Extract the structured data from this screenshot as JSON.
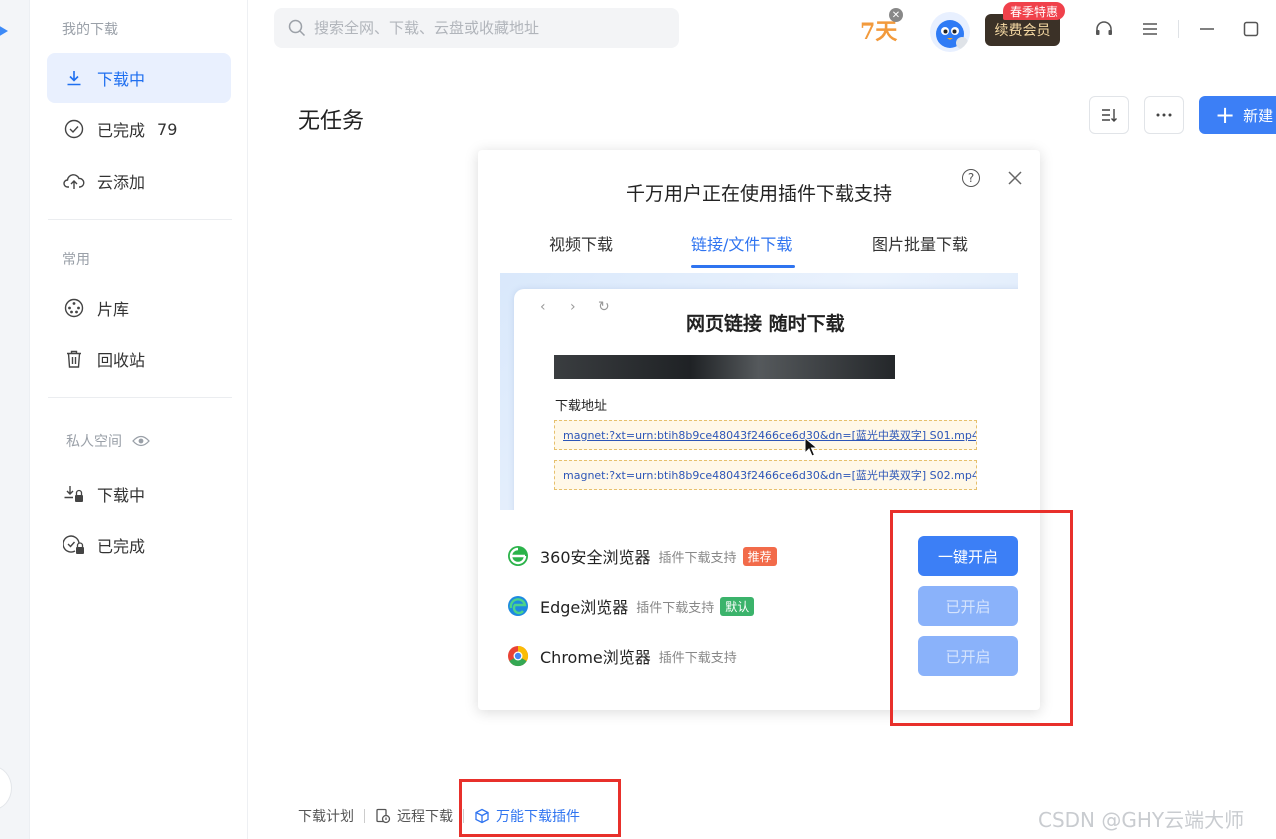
{
  "sidebar": {
    "section_mine": "我的下载",
    "items_main": [
      {
        "label": "下载中",
        "icon": "download-icon"
      },
      {
        "label": "已完成",
        "count": "79",
        "icon": "check-circle-icon"
      },
      {
        "label": "云添加",
        "icon": "cloud-upload-icon"
      }
    ],
    "section_common": "常用",
    "items_common": [
      {
        "label": "片库",
        "icon": "film-reel-icon"
      },
      {
        "label": "回收站",
        "icon": "trash-icon"
      }
    ],
    "section_private": "私人空间",
    "items_private": [
      {
        "label": "下载中",
        "icon": "locked-download-icon"
      },
      {
        "label": "已完成",
        "icon": "locked-check-icon"
      }
    ]
  },
  "topbar": {
    "search_placeholder": "搜索全网、下载、云盘或收藏地址",
    "badge_days": "7天",
    "vip_tag": "春季特惠",
    "vip_button": "续费会员"
  },
  "main": {
    "title": "无任务",
    "new_button": "新建"
  },
  "dialog": {
    "title": "千万用户正在使用插件下载支持",
    "tabs": [
      "视频下载",
      "链接/文件下载",
      "图片批量下载"
    ],
    "active_tab": 1,
    "preview": {
      "headline": "网页链接 随时下载",
      "url_label": "下载地址",
      "urls": [
        "magnet:?xt=urn:btih8b9ce48043f2466ce6d30&dn=[蓝光中英双字] S01.mp4",
        "magnet:?xt=urn:btih8b9ce48043f2466ce6d30&dn=[蓝光中英双字] S02.mp4"
      ]
    },
    "browsers": [
      {
        "name": "360安全浏览器",
        "sub": "插件下载支持",
        "tag": "推荐",
        "tag_color": "#f26b4a",
        "action": "一键开启",
        "state": "primary"
      },
      {
        "name": "Edge浏览器",
        "sub": "插件下载支持",
        "tag": "默认",
        "tag_color": "#3bb36b",
        "action": "已开启",
        "state": "disabled"
      },
      {
        "name": "Chrome浏览器",
        "sub": "插件下载支持",
        "tag": "",
        "tag_color": "",
        "action": "已开启",
        "state": "disabled"
      }
    ]
  },
  "footer": {
    "plan": "下载计划",
    "remote": "远程下载",
    "plugin": "万能下载插件"
  },
  "watermark": "CSDN @GHY云端大师",
  "colors": {
    "accent": "#3c7ff6",
    "highlight": "#e8302b"
  }
}
